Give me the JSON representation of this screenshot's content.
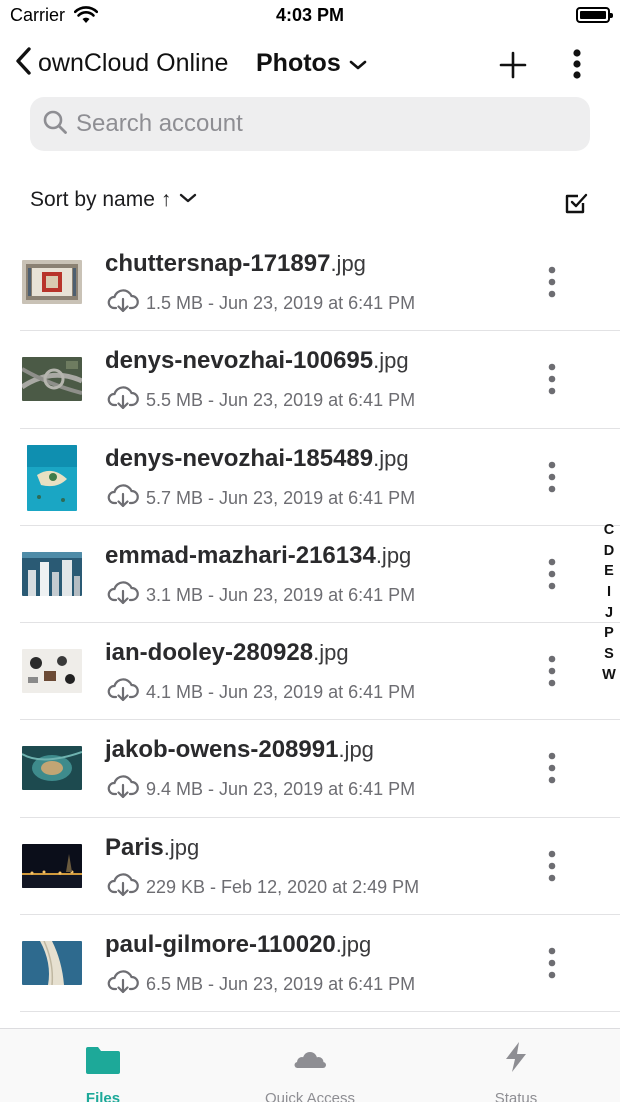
{
  "status_bar": {
    "carrier": "Carrier",
    "time": "4:03 PM"
  },
  "nav": {
    "back_label": "ownCloud Online",
    "folder_title": "Photos",
    "icons": [
      "chevron-left-icon",
      "chevron-down-icon",
      "plus-icon",
      "more-vertical-icon"
    ]
  },
  "search": {
    "placeholder": "Search account",
    "value": ""
  },
  "sort": {
    "label": "Sort by name",
    "direction": "↑"
  },
  "files": [
    {
      "base": "chuttersnap-171897",
      "ext": ".jpg",
      "meta": "1.5 MB - Jun 23, 2019 at 6:41 PM"
    },
    {
      "base": "denys-nevozhai-100695",
      "ext": ".jpg",
      "meta": "5.5 MB - Jun 23, 2019 at 6:41 PM"
    },
    {
      "base": "denys-nevozhai-185489",
      "ext": ".jpg",
      "meta": "5.7 MB - Jun 23, 2019 at 6:41 PM"
    },
    {
      "base": "emmad-mazhari-216134",
      "ext": ".jpg",
      "meta": "3.1 MB - Jun 23, 2019 at 6:41 PM"
    },
    {
      "base": "ian-dooley-280928",
      "ext": ".jpg",
      "meta": "4.1 MB - Jun 23, 2019 at 6:41 PM"
    },
    {
      "base": "jakob-owens-208991",
      "ext": ".jpg",
      "meta": "9.4 MB - Jun 23, 2019 at 6:41 PM"
    },
    {
      "base": "Paris",
      "ext": ".jpg",
      "meta": "229 KB - Feb 12, 2020 at 2:49 PM"
    },
    {
      "base": "paul-gilmore-110020",
      "ext": ".jpg",
      "meta": "6.5 MB - Jun 23, 2019 at 6:41 PM"
    }
  ],
  "section_index": [
    "C",
    "D",
    "E",
    "I",
    "J",
    "P",
    "S",
    "W"
  ],
  "tabs": [
    {
      "label": "Files",
      "icon": "folder-icon",
      "active": true
    },
    {
      "label": "Quick Access",
      "icon": "cloud-icon",
      "active": false
    },
    {
      "label": "Status",
      "icon": "bolt-icon",
      "active": false
    }
  ],
  "colors": {
    "accent": "#1da999",
    "inactive_tab": "#8e8e93",
    "search_bg": "#eeeeef"
  }
}
